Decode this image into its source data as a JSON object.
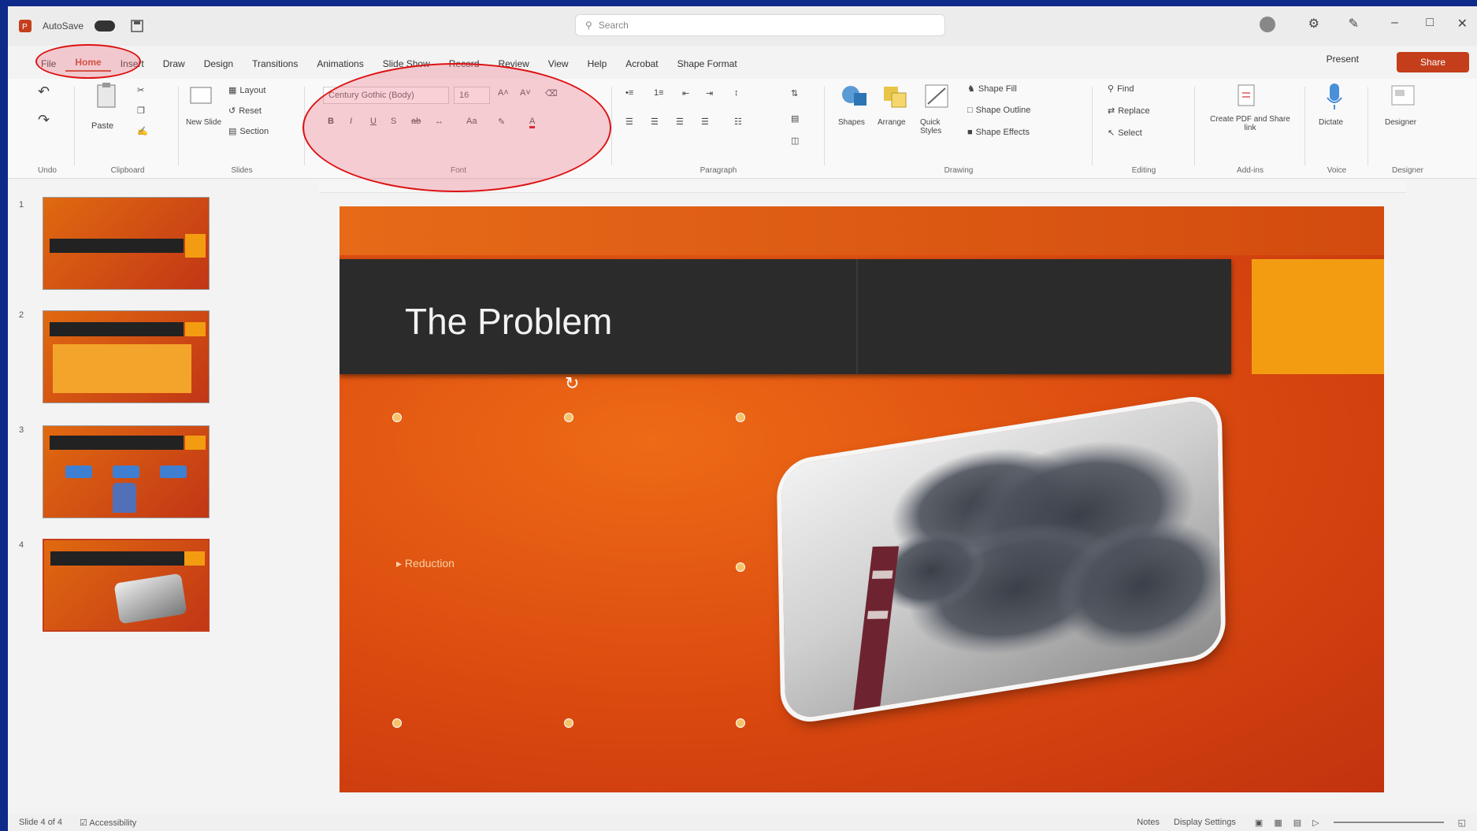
{
  "window": {
    "autosave_label": "AutoSave",
    "file_name": "",
    "search_placeholder": "Search",
    "user_name": ""
  },
  "tabs": [
    {
      "label": "File"
    },
    {
      "label": "Home"
    },
    {
      "label": "Insert"
    },
    {
      "label": "Draw"
    },
    {
      "label": "Design"
    },
    {
      "label": "Transitions"
    },
    {
      "label": "Animations"
    },
    {
      "label": "Slide Show"
    },
    {
      "label": "Record"
    },
    {
      "label": "Review"
    },
    {
      "label": "View"
    },
    {
      "label": "Help"
    },
    {
      "label": "Acrobat"
    },
    {
      "label": "Shape Format"
    }
  ],
  "active_tab": "Home",
  "header_buttons": {
    "present": "Present",
    "share": "Share"
  },
  "ribbon": {
    "groups": [
      {
        "label": "Undo"
      },
      {
        "label": "Clipboard"
      },
      {
        "label": "Slides"
      },
      {
        "label": "Font"
      },
      {
        "label": "Paragraph"
      },
      {
        "label": "Drawing"
      },
      {
        "label": "Editing"
      },
      {
        "label": "Add-ins"
      },
      {
        "label": "Voice"
      },
      {
        "label": "Designer"
      }
    ],
    "clipboard": {
      "paste": "Paste"
    },
    "slides": {
      "new_slide": "New Slide",
      "layout": "Layout",
      "reset": "Reset",
      "section": "Section"
    },
    "font": {
      "font_name": "Century Gothic (Body)",
      "font_size": "16"
    },
    "drawing": {
      "shapes": "Shapes",
      "arrange": "Arrange",
      "quick_styles": "Quick Styles",
      "shape_fill": "Shape Fill",
      "shape_outline": "Shape Outline",
      "shape_effects": "Shape Effects"
    },
    "editing": {
      "find": "Find",
      "replace": "Replace",
      "select": "Select"
    },
    "addins": {
      "label": "Create PDF and Share link"
    },
    "voice": {
      "dictate": "Dictate"
    },
    "designer": {
      "label": "Designer"
    }
  },
  "slides_pane": {
    "thumbnails": [
      {
        "number": "1"
      },
      {
        "number": "2"
      },
      {
        "number": "3"
      },
      {
        "number": "4"
      }
    ]
  },
  "slide": {
    "title": "The Problem",
    "bullet": "Reduction",
    "caption": ""
  },
  "status_bar": {
    "slide_info": "Slide 4 of 4",
    "accessibility": "Accessibility",
    "notes": "Notes",
    "display_settings": "Display Settings"
  },
  "colors": {
    "accent": "#c43e1c",
    "slide_orange": "#d9480f",
    "title_bar": "#2b2b2b",
    "accent_square": "#f39c12",
    "annotation": "#dd1111"
  }
}
